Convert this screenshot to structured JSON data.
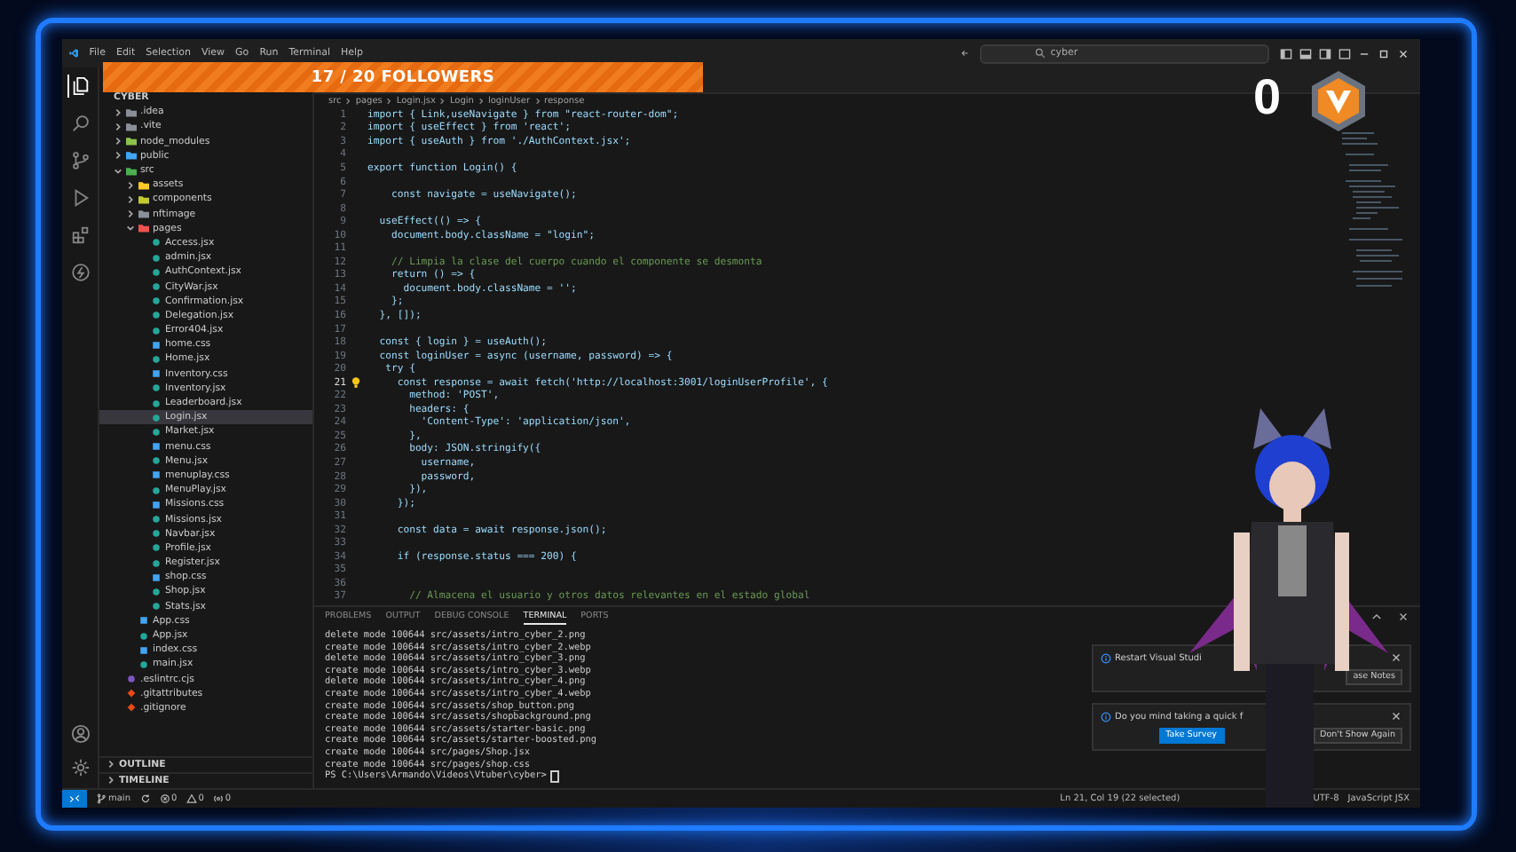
{
  "window": {
    "menu": [
      "File",
      "Edit",
      "Selection",
      "View",
      "Go",
      "Run",
      "Terminal",
      "Help"
    ],
    "search": {
      "value": "cyber"
    }
  },
  "overlay": {
    "followers": "17 / 20 FOLLOWERS",
    "counter": "0"
  },
  "activity_bar": [
    {
      "kind": "files",
      "selected": true
    },
    {
      "kind": "search",
      "selected": false
    },
    {
      "kind": "branch",
      "selected": false
    },
    {
      "kind": "run",
      "selected": false
    },
    {
      "kind": "extensions",
      "selected": false
    },
    {
      "kind": "bolt",
      "selected": false
    }
  ],
  "sidebar": {
    "root": "CYBER",
    "tree": [
      {
        "name": ".idea",
        "kind": "folder",
        "color": "#8a8f98",
        "expanded": false,
        "selected": false
      },
      {
        "name": ".vite",
        "kind": "folder",
        "color": "#8a8f98",
        "expanded": false,
        "selected": false
      },
      {
        "name": "node_modules",
        "kind": "folder",
        "color": "#8bc34a",
        "expanded": false,
        "selected": false
      },
      {
        "name": "public",
        "kind": "folder",
        "color": "#42a5f5",
        "expanded": false,
        "selected": false
      },
      {
        "name": "src",
        "kind": "folder",
        "color": "#4caf50",
        "expanded": true,
        "selected": false,
        "children": [
          {
            "name": "assets",
            "kind": "folder",
            "color": "#ffca28",
            "expanded": false,
            "selected": false
          },
          {
            "name": "components",
            "kind": "folder",
            "color": "#c0ca33",
            "expanded": false,
            "selected": false
          },
          {
            "name": "nftimage",
            "kind": "folder",
            "color": "#8a8f98",
            "expanded": false,
            "selected": false
          },
          {
            "name": "pages",
            "kind": "folder",
            "color": "#ef5350",
            "expanded": true,
            "selected": false,
            "children": [
              {
                "name": "Access.jsx",
                "kind": "jsx",
                "selected": false
              },
              {
                "name": "admin.jsx",
                "kind": "jsx",
                "selected": false
              },
              {
                "name": "AuthContext.jsx",
                "kind": "jsx",
                "selected": false
              },
              {
                "name": "CityWar.jsx",
                "kind": "jsx",
                "selected": false
              },
              {
                "name": "Confirmation.jsx",
                "kind": "jsx",
                "selected": false
              },
              {
                "name": "Delegation.jsx",
                "kind": "jsx",
                "selected": false
              },
              {
                "name": "Error404.jsx",
                "kind": "jsx",
                "selected": false
              },
              {
                "name": "home.css",
                "kind": "css",
                "selected": false
              },
              {
                "name": "Home.jsx",
                "kind": "jsx",
                "selected": false
              },
              {
                "name": "Inventory.css",
                "kind": "css",
                "selected": false
              },
              {
                "name": "Inventory.jsx",
                "kind": "jsx",
                "selected": false
              },
              {
                "name": "Leaderboard.jsx",
                "kind": "jsx",
                "selected": false
              },
              {
                "name": "Login.jsx",
                "kind": "jsx",
                "selected": true
              },
              {
                "name": "Market.jsx",
                "kind": "jsx",
                "selected": false
              },
              {
                "name": "menu.css",
                "kind": "css",
                "selected": false
              },
              {
                "name": "Menu.jsx",
                "kind": "jsx",
                "selected": false
              },
              {
                "name": "menuplay.css",
                "kind": "css",
                "selected": false
              },
              {
                "name": "MenuPlay.jsx",
                "kind": "jsx",
                "selected": false
              },
              {
                "name": "Missions.css",
                "kind": "css",
                "selected": false
              },
              {
                "name": "Missions.jsx",
                "kind": "jsx",
                "selected": false
              },
              {
                "name": "Navbar.jsx",
                "kind": "jsx",
                "selected": false
              },
              {
                "name": "Profile.jsx",
                "kind": "jsx",
                "selected": false
              },
              {
                "name": "Register.jsx",
                "kind": "jsx",
                "selected": false
              },
              {
                "name": "shop.css",
                "kind": "css",
                "selected": false
              },
              {
                "name": "Shop.jsx",
                "kind": "jsx",
                "selected": false
              },
              {
                "name": "Stats.jsx",
                "kind": "jsx",
                "selected": false
              }
            ]
          },
          {
            "name": "App.css",
            "kind": "css",
            "selected": false
          },
          {
            "name": "App.jsx",
            "kind": "jsx",
            "selected": false
          },
          {
            "name": "index.css",
            "kind": "css",
            "selected": false
          },
          {
            "name": "main.jsx",
            "kind": "jsx",
            "selected": false
          }
        ]
      },
      {
        "name": ".eslintrc.cjs",
        "kind": "eslint",
        "selected": false
      },
      {
        "name": ".gitattributes",
        "kind": "git",
        "selected": false
      },
      {
        "name": ".gitignore",
        "kind": "git",
        "selected": false
      }
    ],
    "sections": [
      "OUTLINE",
      "TIMELINE"
    ]
  },
  "editor": {
    "breadcrumb": [
      "src",
      "pages",
      "Login.jsx",
      "Login",
      "loginUser",
      "response"
    ],
    "lines": [
      {
        "n": "1",
        "kind": "code",
        "text": "import { Link,useNavigate } from \"react-router-dom\";"
      },
      {
        "n": "2",
        "kind": "code",
        "text": "import { useEffect } from 'react';"
      },
      {
        "n": "3",
        "kind": "code",
        "text": "import { useAuth } from './AuthContext.jsx';"
      },
      {
        "n": "4",
        "kind": "code"
      },
      {
        "n": "5",
        "kind": "code",
        "text": "export function Login() {"
      },
      {
        "n": "6",
        "kind": "code"
      },
      {
        "n": "7",
        "kind": "code",
        "text": "    const navigate = useNavigate();"
      },
      {
        "n": "8",
        "kind": "code"
      },
      {
        "n": "9",
        "kind": "code",
        "text": "  useEffect(() => {"
      },
      {
        "n": "10",
        "kind": "code",
        "text": "    document.body.className = \"login\";"
      },
      {
        "n": "11",
        "kind": "code"
      },
      {
        "n": "12",
        "kind": "comment",
        "text": "    // Limpia la clase del cuerpo cuando el componente se desmonta"
      },
      {
        "n": "13",
        "kind": "code",
        "text": "    return () => {"
      },
      {
        "n": "14",
        "kind": "code",
        "text": "      document.body.className = '';"
      },
      {
        "n": "15",
        "kind": "code",
        "text": "    };"
      },
      {
        "n": "16",
        "kind": "code",
        "text": "  }, []);"
      },
      {
        "n": "17",
        "kind": "code"
      },
      {
        "n": "18",
        "kind": "code",
        "text": "  const { login } = useAuth();"
      },
      {
        "n": "19",
        "kind": "code",
        "text": "  const loginUser = async (username, password) => {"
      },
      {
        "n": "20",
        "kind": "code",
        "text": "   try {"
      },
      {
        "n": "21",
        "kind": "active",
        "text": "     const response = await fetch('http://localhost:3001/loginUserProfile', {"
      },
      {
        "n": "22",
        "kind": "code",
        "text": "       method: 'POST',"
      },
      {
        "n": "23",
        "kind": "code",
        "text": "       headers: {"
      },
      {
        "n": "24",
        "kind": "code",
        "text": "         'Content-Type': 'application/json',"
      },
      {
        "n": "25",
        "kind": "code",
        "text": "       },"
      },
      {
        "n": "26",
        "kind": "code",
        "text": "       body: JSON.stringify({"
      },
      {
        "n": "27",
        "kind": "code",
        "text": "         username,"
      },
      {
        "n": "28",
        "kind": "code",
        "text": "         password,"
      },
      {
        "n": "29",
        "kind": "code",
        "text": "       }),"
      },
      {
        "n": "30",
        "kind": "code",
        "text": "     });"
      },
      {
        "n": "31",
        "kind": "code"
      },
      {
        "n": "32",
        "kind": "code",
        "text": "     const data = await response.json();"
      },
      {
        "n": "33",
        "kind": "code"
      },
      {
        "n": "34",
        "kind": "code",
        "text": "     if (response.status === 200) {"
      },
      {
        "n": "35",
        "kind": "code"
      },
      {
        "n": "36",
        "kind": "code"
      },
      {
        "n": "37",
        "kind": "comment",
        "text": "       // Almacena el usuario y otros datos relevantes en el estado global"
      }
    ]
  },
  "panel": {
    "tabs": [
      {
        "label": "PROBLEMS",
        "selected": false
      },
      {
        "label": "OUTPUT",
        "selected": false
      },
      {
        "label": "DEBUG CONSOLE",
        "selected": false
      },
      {
        "label": "TERMINAL",
        "selected": true
      },
      {
        "label": "PORTS",
        "selected": false
      }
    ],
    "terminal": [
      "delete mode 100644 src/assets/intro_cyber_2.png",
      "create mode 100644 src/assets/intro_cyber_2.webp",
      "delete mode 100644 src/assets/intro_cyber_3.png",
      "create mode 100644 src/assets/intro_cyber_3.webp",
      "delete mode 100644 src/assets/intro_cyber_4.png",
      "create mode 100644 src/assets/intro_cyber_4.webp",
      "create mode 100644 src/assets/shop_button.png",
      "create mode 100644 src/assets/shopbackground.png",
      "create mode 100644 src/assets/starter-basic.png",
      "create mode 100644 src/assets/starter-boosted.png",
      "create mode 100644 src/pages/Shop.jsx",
      "create mode 100644 src/pages/shop.css"
    ],
    "prompt": "PS C:\\Users\\Armando\\Videos\\Vtuber\\cyber>"
  },
  "notifications": [
    {
      "message": "Restart Visual Studi",
      "buttons": [
        {
          "label": "ase Notes",
          "primary": false
        }
      ]
    },
    {
      "message": "Do you mind taking a quick f",
      "buttons": [
        {
          "label": "Take Survey",
          "primary": true
        },
        {
          "label": "Don't Show Again",
          "primary": false
        }
      ]
    }
  ],
  "status_bar": {
    "left": [
      {
        "kind": "remote"
      },
      {
        "kind": "branch",
        "text": "main"
      },
      {
        "kind": "sync"
      },
      {
        "kind": "errors",
        "text": "0"
      },
      {
        "kind": "warnings",
        "text": "0"
      },
      {
        "kind": "ports",
        "text": "0"
      }
    ],
    "right": [
      "Ln 21, Col 19 (22 selected)",
      "UTF-8",
      "JavaScript JSX"
    ]
  }
}
